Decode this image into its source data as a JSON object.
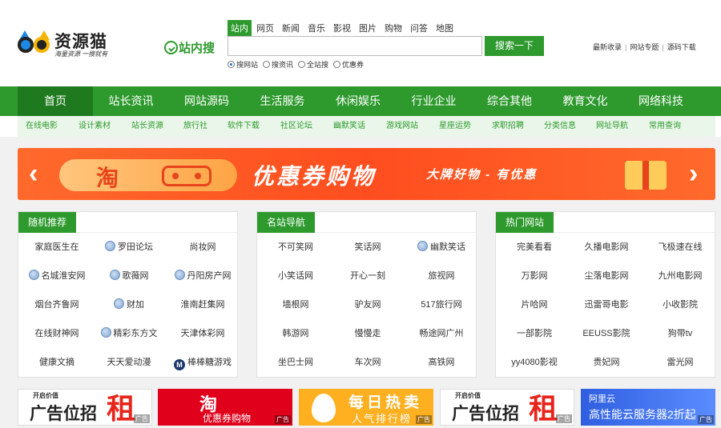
{
  "brand": {
    "name": "资源猫",
    "slogan": "海量资源 一搜就有"
  },
  "site_search_label": "站内搜",
  "search": {
    "tabs": [
      "站内",
      "网页",
      "新闻",
      "音乐",
      "影视",
      "图片",
      "购物",
      "问答",
      "地图"
    ],
    "active_tab": "站内",
    "placeholder": "",
    "button": "搜索一下",
    "options": [
      "搜网站",
      "搜资讯",
      "全站搜",
      "优惠券"
    ],
    "selected_option": "搜网站"
  },
  "toplinks": [
    "最新收录",
    "网站专题",
    "源码下载"
  ],
  "nav": {
    "items": [
      "首页",
      "站长资讯",
      "网站源码",
      "生活服务",
      "休闲娱乐",
      "行业企业",
      "综合其他",
      "教育文化",
      "网络科技"
    ],
    "active": "首页"
  },
  "subnav": [
    "在线电影",
    "设计素材",
    "站长资源",
    "旅行社",
    "软件下载",
    "社区论坛",
    "幽默笑话",
    "游戏网站",
    "星座运势",
    "求职招聘",
    "分类信息",
    "网址导航",
    "常用查询"
  ],
  "banner": {
    "tao": "淘",
    "main": "优惠券购物",
    "sub": "大牌好物 - 有优惠",
    "prev": "‹",
    "next": "›"
  },
  "panels": [
    {
      "title": "随机推荐",
      "rows": [
        [
          {
            "label": "家庭医生在",
            "icon": ""
          },
          {
            "label": "罗田论坛",
            "icon": "globe-icon"
          },
          {
            "label": "尚妆网",
            "icon": ""
          }
        ],
        [
          {
            "label": "名城淮安网",
            "icon": "globe-icon"
          },
          {
            "label": "歌薇网",
            "icon": "globe-icon"
          },
          {
            "label": "丹阳房产网",
            "icon": "globe-icon"
          }
        ],
        [
          {
            "label": "烟台齐鲁网",
            "icon": ""
          },
          {
            "label": "财加",
            "icon": "globe-icon"
          },
          {
            "label": "淮南赶集网",
            "icon": ""
          }
        ],
        [
          {
            "label": "在线财神网",
            "icon": ""
          },
          {
            "label": "精彩东方文",
            "icon": "globe-icon"
          },
          {
            "label": "天津体彩网",
            "icon": ""
          }
        ],
        [
          {
            "label": "健康文摘",
            "icon": ""
          },
          {
            "label": "天天爱动漫",
            "icon": ""
          },
          {
            "label": "棒棒糖游戏",
            "icon": "m-icon"
          }
        ]
      ]
    },
    {
      "title": "名站导航",
      "rows": [
        [
          {
            "label": "不可笑网",
            "icon": ""
          },
          {
            "label": "笑话网",
            "icon": ""
          },
          {
            "label": "幽默笑话",
            "icon": "globe-icon"
          }
        ],
        [
          {
            "label": "小笑话网",
            "icon": ""
          },
          {
            "label": "开心一刻",
            "icon": ""
          },
          {
            "label": "旅视网",
            "icon": ""
          }
        ],
        [
          {
            "label": "墙根网",
            "icon": ""
          },
          {
            "label": "驴友网",
            "icon": ""
          },
          {
            "label": "517旅行网",
            "icon": ""
          }
        ],
        [
          {
            "label": "韩游网",
            "icon": ""
          },
          {
            "label": "慢慢走",
            "icon": ""
          },
          {
            "label": "畅途网广州",
            "icon": ""
          }
        ],
        [
          {
            "label": "坐巴士网",
            "icon": ""
          },
          {
            "label": "车次网",
            "icon": ""
          },
          {
            "label": "高铁网",
            "icon": ""
          }
        ]
      ]
    },
    {
      "title": "热门网站",
      "rows": [
        [
          {
            "label": "完美看看",
            "icon": ""
          },
          {
            "label": "久播电影网",
            "icon": ""
          },
          {
            "label": "飞极速在线",
            "icon": ""
          }
        ],
        [
          {
            "label": "万影网",
            "icon": ""
          },
          {
            "label": "尘落电影网",
            "icon": ""
          },
          {
            "label": "九州电影网",
            "icon": ""
          }
        ],
        [
          {
            "label": "片哈网",
            "icon": ""
          },
          {
            "label": "迅雷哥电影",
            "icon": ""
          },
          {
            "label": "小收影院",
            "icon": ""
          }
        ],
        [
          {
            "label": "一部影院",
            "icon": ""
          },
          {
            "label": "EEUSS影院",
            "icon": ""
          },
          {
            "label": "狗带tv",
            "icon": ""
          }
        ],
        [
          {
            "label": "yy4080影视",
            "icon": ""
          },
          {
            "label": "贵妃网",
            "icon": ""
          },
          {
            "label": "雷光网",
            "icon": ""
          }
        ]
      ]
    }
  ],
  "ads": {
    "tag": "广告",
    "ad1": {
      "kw": "开启价值",
      "t1": "广告位招",
      "t2": "租"
    },
    "ad2": {
      "t1": "淘",
      "t2": "优惠券购物"
    },
    "ad3": {
      "t1": "每日热卖",
      "t2": "人气排行榜"
    },
    "ad4": {
      "kw": "开启价值",
      "t1": "广告位招",
      "t2": "租"
    },
    "ad5": {
      "t1": "阿里云",
      "t2": "高性能云服务器2折起"
    }
  },
  "colors": {
    "brand_green": "#2e9a2e",
    "nav_active": "#1f7a1f",
    "banner_orange": "#ff4d1f",
    "ad_red": "#e0001b"
  }
}
